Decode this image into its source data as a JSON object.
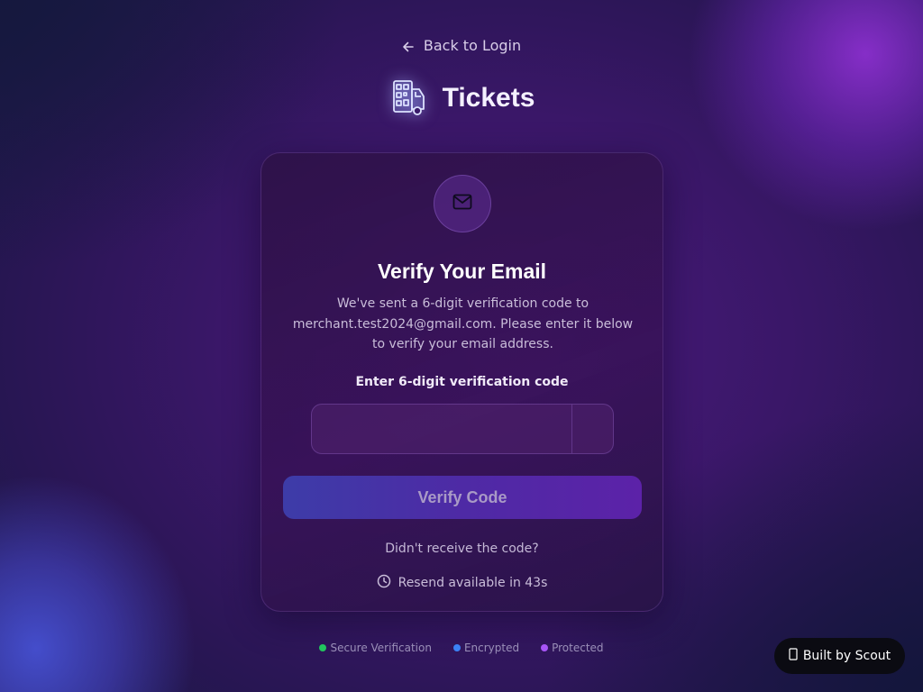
{
  "back_link": {
    "label": "Back to Login",
    "icon": "arrow-left-icon"
  },
  "brand": {
    "name": "Tickets",
    "logo_icon": "ticket-truck-icon"
  },
  "card": {
    "icon": "mail-icon",
    "title": "Verify Your Email",
    "description": "We've sent a 6-digit verification code to merchant.test2024@gmail.com. Please enter it below to verify your email address.",
    "code_label": "Enter 6-digit verification code",
    "code_digits": [
      "",
      "",
      "",
      "",
      "",
      ""
    ],
    "verify_button": "Verify Code",
    "resend_question": "Didn't receive the code?",
    "resend_timer": "Resend available in 43s",
    "timer_icon": "clock-icon"
  },
  "badges": [
    {
      "label": "Secure Verification",
      "color": "#22c55e"
    },
    {
      "label": "Encrypted",
      "color": "#3b82f6"
    },
    {
      "label": "Protected",
      "color": "#a855f7"
    }
  ],
  "scout_badge": {
    "label": "Built by Scout",
    "icon": "box-icon"
  },
  "colors": {
    "verify_gradient_start": "#3d3ca8",
    "verify_gradient_end": "#5c22a8",
    "accent_purple": "#7b2fbf"
  }
}
